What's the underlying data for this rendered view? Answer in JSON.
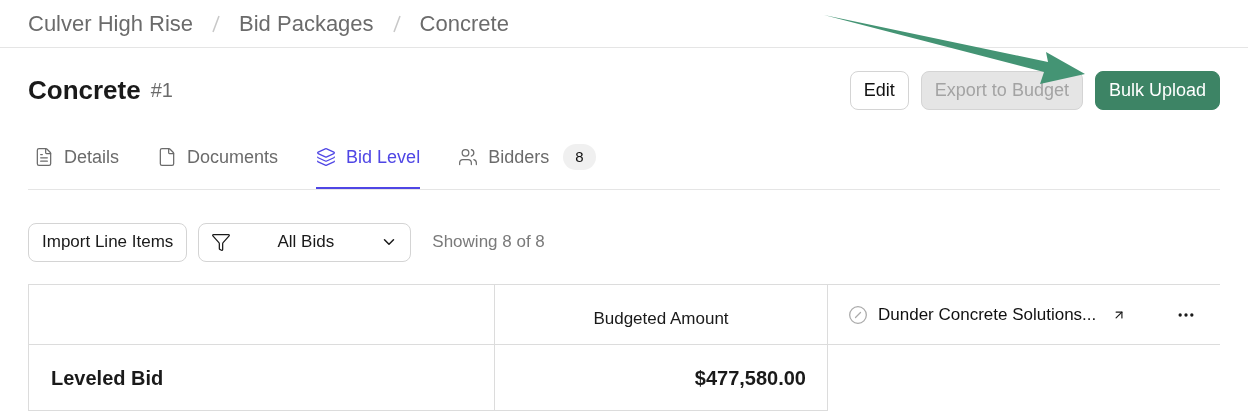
{
  "breadcrumb": [
    "Culver High Rise",
    "Bid Packages",
    "Concrete"
  ],
  "title": "Concrete",
  "number": "#1",
  "actions": [
    {
      "label": "Edit",
      "kind": "outline",
      "disabled": false
    },
    {
      "label": "Export to Budget",
      "kind": "outline",
      "disabled": true
    },
    {
      "label": "Bulk Upload",
      "kind": "primary",
      "disabled": false
    }
  ],
  "tabs": [
    {
      "label": "Details",
      "selected": false
    },
    {
      "label": "Documents",
      "selected": false
    },
    {
      "label": "Bid Level",
      "selected": true
    },
    {
      "label": "Bidders",
      "selected": false,
      "count": "8"
    }
  ],
  "toolbar": {
    "import_button": "Import Line Items",
    "filter": {
      "value": "All Bids"
    },
    "showing": "Showing 8 of 8"
  },
  "table": {
    "columns": [
      {
        "kind": "blank"
      },
      {
        "kind": "text",
        "label": "Budgeted Amount"
      },
      {
        "kind": "bidder",
        "label": "Dunder Concrete Solutions..."
      }
    ],
    "rows": [
      {
        "label": "Leveled Bid",
        "budgeted": "$477,580.00"
      }
    ]
  },
  "annotation": {
    "kind": "arrow"
  }
}
